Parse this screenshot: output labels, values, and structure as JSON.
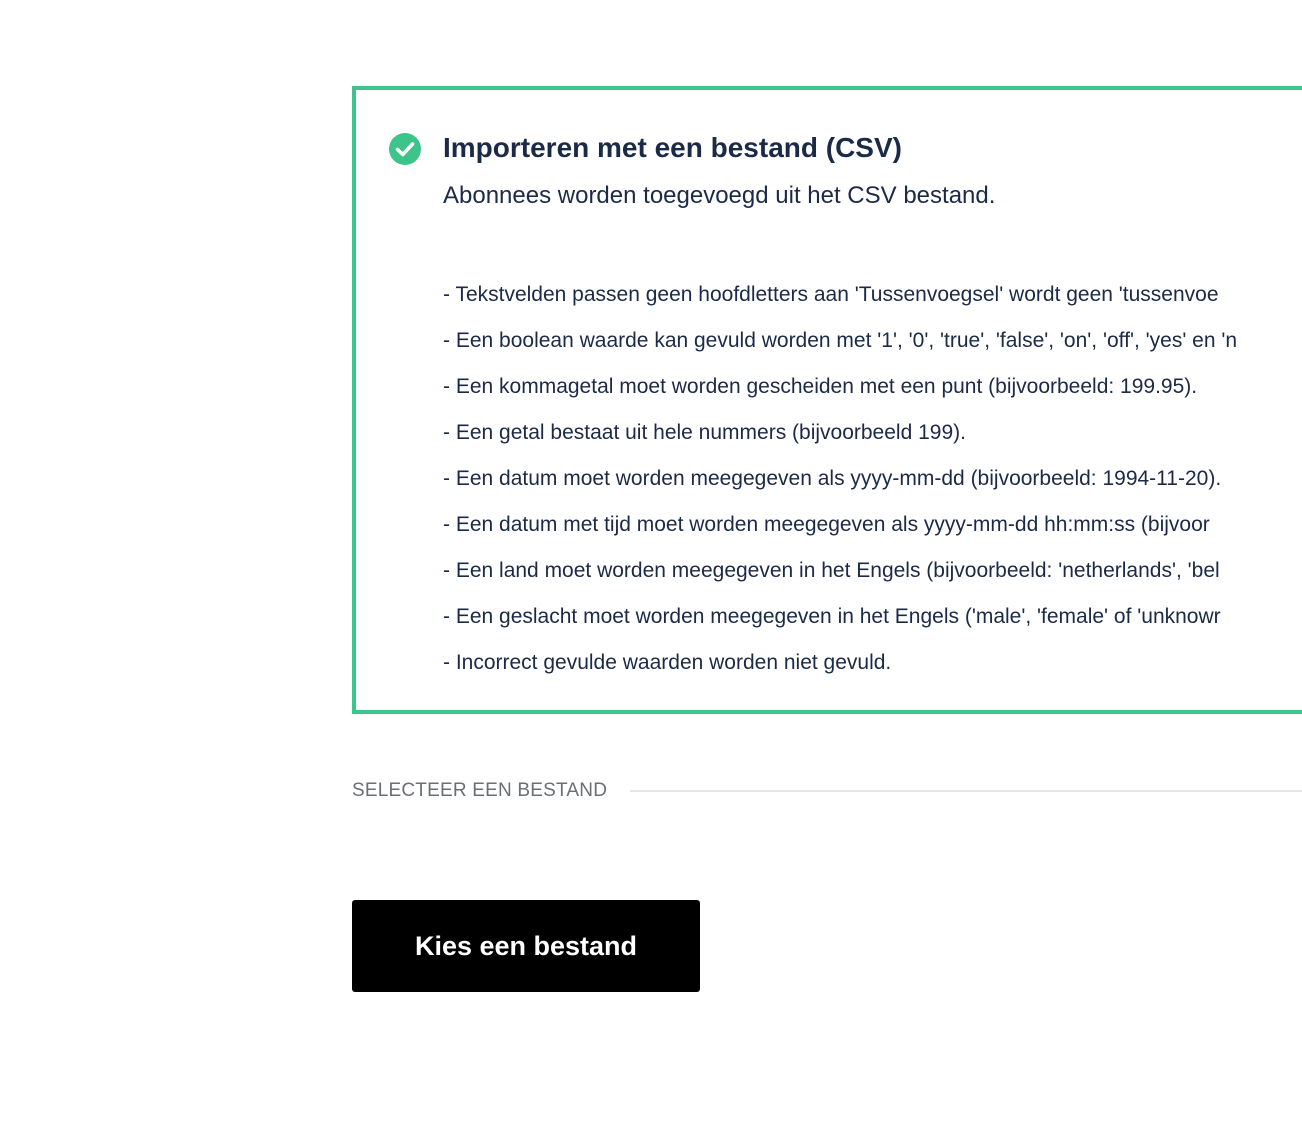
{
  "colors": {
    "success_border": "#3cc48a",
    "success_icon": "#3cc48a",
    "text": "#1b2a47",
    "muted_label": "#6b6f75",
    "button_bg": "#000000",
    "button_text": "#ffffff"
  },
  "notice": {
    "icon": "check-circle-icon",
    "title": "Importeren met een bestand (CSV)",
    "subtitle": "Abonnees worden toegevoegd uit het CSV bestand.",
    "rules": [
      "- Tekstvelden passen geen hoofdletters aan 'Tussenvoegsel' wordt geen 'tussenvoe",
      "- Een boolean waarde kan gevuld worden met '1', '0', 'true', 'false', 'on', 'off', 'yes' en 'n",
      "- Een kommagetal moet worden gescheiden met een punt (bijvoorbeeld: 199.95).",
      "- Een getal bestaat uit hele nummers (bijvoorbeeld 199).",
      "- Een datum moet worden meegegeven als yyyy-mm-dd (bijvoorbeeld: 1994-11-20).",
      "- Een datum met tijd moet worden meegegeven als yyyy-mm-dd hh:mm:ss (bijvoor",
      "- Een land moet worden meegegeven in het Engels (bijvoorbeeld: 'netherlands', 'bel",
      "- Een geslacht moet worden meegegeven in het Engels ('male', 'female' of 'unknowr",
      "- Incorrect gevulde waarden worden niet gevuld."
    ]
  },
  "file_section": {
    "label": "SELECTEER EEN BESTAND",
    "button_label": "Kies een bestand"
  }
}
